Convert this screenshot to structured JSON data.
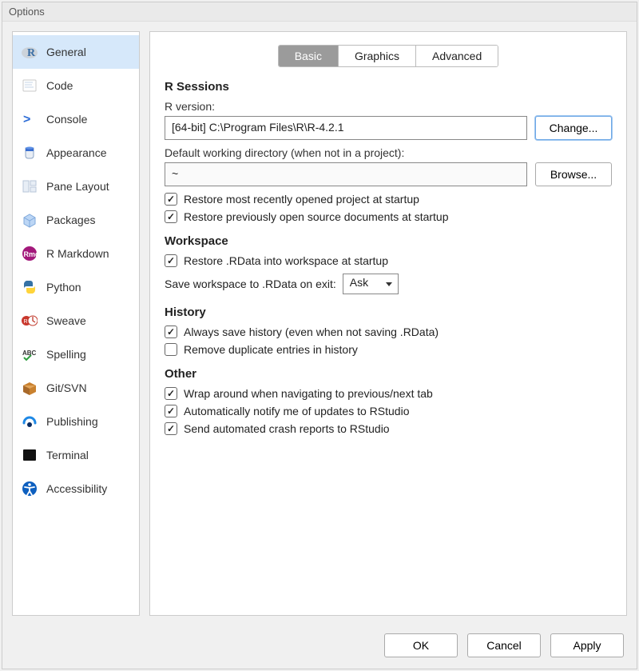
{
  "window": {
    "title": "Options"
  },
  "sidebar": {
    "items": [
      {
        "label": "General",
        "selected": true
      },
      {
        "label": "Code",
        "selected": false
      },
      {
        "label": "Console",
        "selected": false
      },
      {
        "label": "Appearance",
        "selected": false
      },
      {
        "label": "Pane Layout",
        "selected": false
      },
      {
        "label": "Packages",
        "selected": false
      },
      {
        "label": "R Markdown",
        "selected": false
      },
      {
        "label": "Python",
        "selected": false
      },
      {
        "label": "Sweave",
        "selected": false
      },
      {
        "label": "Spelling",
        "selected": false
      },
      {
        "label": "Git/SVN",
        "selected": false
      },
      {
        "label": "Publishing",
        "selected": false
      },
      {
        "label": "Terminal",
        "selected": false
      },
      {
        "label": "Accessibility",
        "selected": false
      }
    ]
  },
  "tabs": {
    "items": [
      "Basic",
      "Graphics",
      "Advanced"
    ],
    "active": 0
  },
  "sections": {
    "r_sessions": {
      "heading": "R Sessions",
      "r_version_label": "R version:",
      "r_version_value": "[64-bit] C:\\Program Files\\R\\R-4.2.1",
      "change_button": "Change...",
      "working_dir_label": "Default working directory (when not in a project):",
      "working_dir_value": "~",
      "browse_button": "Browse...",
      "restore_project": {
        "label": "Restore most recently opened project at startup",
        "checked": true
      },
      "restore_docs": {
        "label": "Restore previously open source documents at startup",
        "checked": true
      }
    },
    "workspace": {
      "heading": "Workspace",
      "restore_rdata": {
        "label": "Restore .RData into workspace at startup",
        "checked": true
      },
      "save_workspace_label": "Save workspace to .RData on exit:",
      "save_workspace_value": "Ask"
    },
    "history": {
      "heading": "History",
      "always_save": {
        "label": "Always save history (even when not saving .RData)",
        "checked": true
      },
      "remove_dupes": {
        "label": "Remove duplicate entries in history",
        "checked": false
      }
    },
    "other": {
      "heading": "Other",
      "wrap_tabs": {
        "label": "Wrap around when navigating to previous/next tab",
        "checked": true
      },
      "notify_updates": {
        "label": "Automatically notify me of updates to RStudio",
        "checked": true
      },
      "crash_reports": {
        "label": "Send automated crash reports to RStudio",
        "checked": true
      }
    }
  },
  "footer": {
    "ok": "OK",
    "cancel": "Cancel",
    "apply": "Apply"
  }
}
